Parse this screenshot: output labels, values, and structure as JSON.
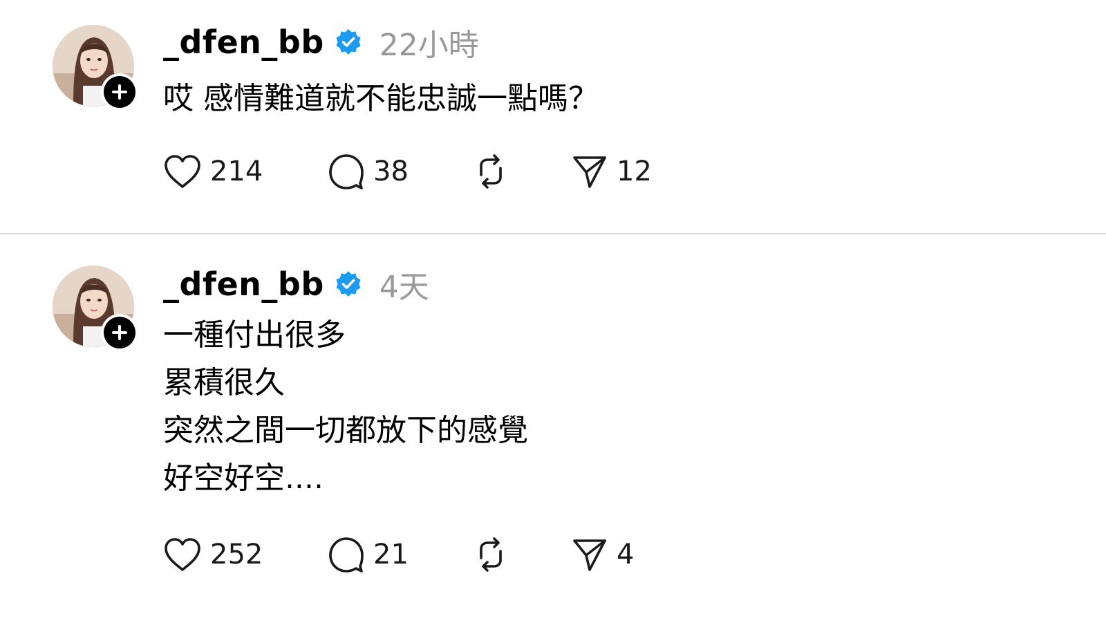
{
  "colors": {
    "verified": "#1d9bf0",
    "timestamp": "#999999",
    "divider": "#dcdcdc",
    "text": "#000000"
  },
  "posts": [
    {
      "username": "_dfen_bb",
      "verified_icon": "verified-badge-icon",
      "timestamp": "22小時",
      "lines": [
        "哎 感情難道就不能忠誠一點嗎？"
      ],
      "likes": "214",
      "replies": "38",
      "reposts": "",
      "shares": "12"
    },
    {
      "username": "_dfen_bb",
      "verified_icon": "verified-badge-icon",
      "timestamp": "4天",
      "lines": [
        "一種付出很多",
        "累積很久",
        "突然之間一切都放下的感覺",
        "好空好空...."
      ],
      "likes": "252",
      "replies": "21",
      "reposts": "",
      "shares": "4"
    }
  ]
}
